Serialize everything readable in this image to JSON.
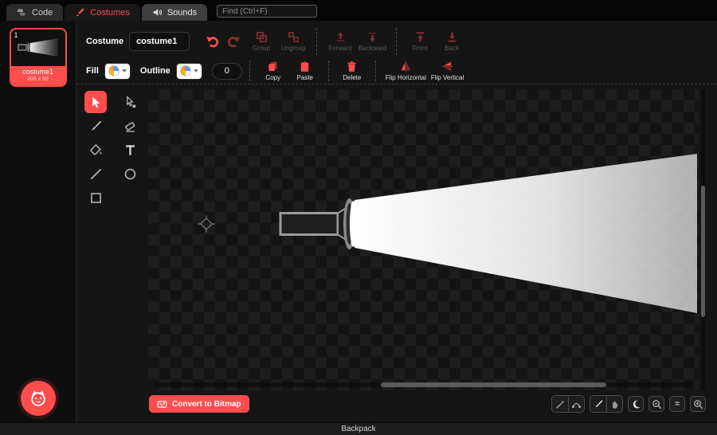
{
  "colors": {
    "accent": "#ff4c4c"
  },
  "tabbar": {
    "tabs": [
      {
        "label": "Code"
      },
      {
        "label": "Costumes"
      },
      {
        "label": "Sounds"
      }
    ],
    "find_placeholder": "Find (Ctrl+F)"
  },
  "costume_panel": {
    "card": {
      "index": "1",
      "name": "costume1",
      "size": "205 x 92"
    }
  },
  "toolbar": {
    "costume_label": "Costume",
    "costume_name": "costume1",
    "group_label": "Group",
    "ungroup_label": "Ungroup",
    "forward_label": "Forward",
    "backward_label": "Backward",
    "front_label": "Front",
    "back_label": "Back",
    "fill_label": "Fill",
    "outline_label": "Outline",
    "outline_width": "0",
    "copy_label": "Copy",
    "paste_label": "Paste",
    "delete_label": "Delete",
    "flip_h_label": "Flip Horizontal",
    "flip_v_label": "Flip Vertical"
  },
  "canvas_area": {
    "convert_bitmap_label": "Convert to Bitmap",
    "zoom_reset_label": "="
  },
  "footer": {
    "backpack_label": "Backpack"
  }
}
